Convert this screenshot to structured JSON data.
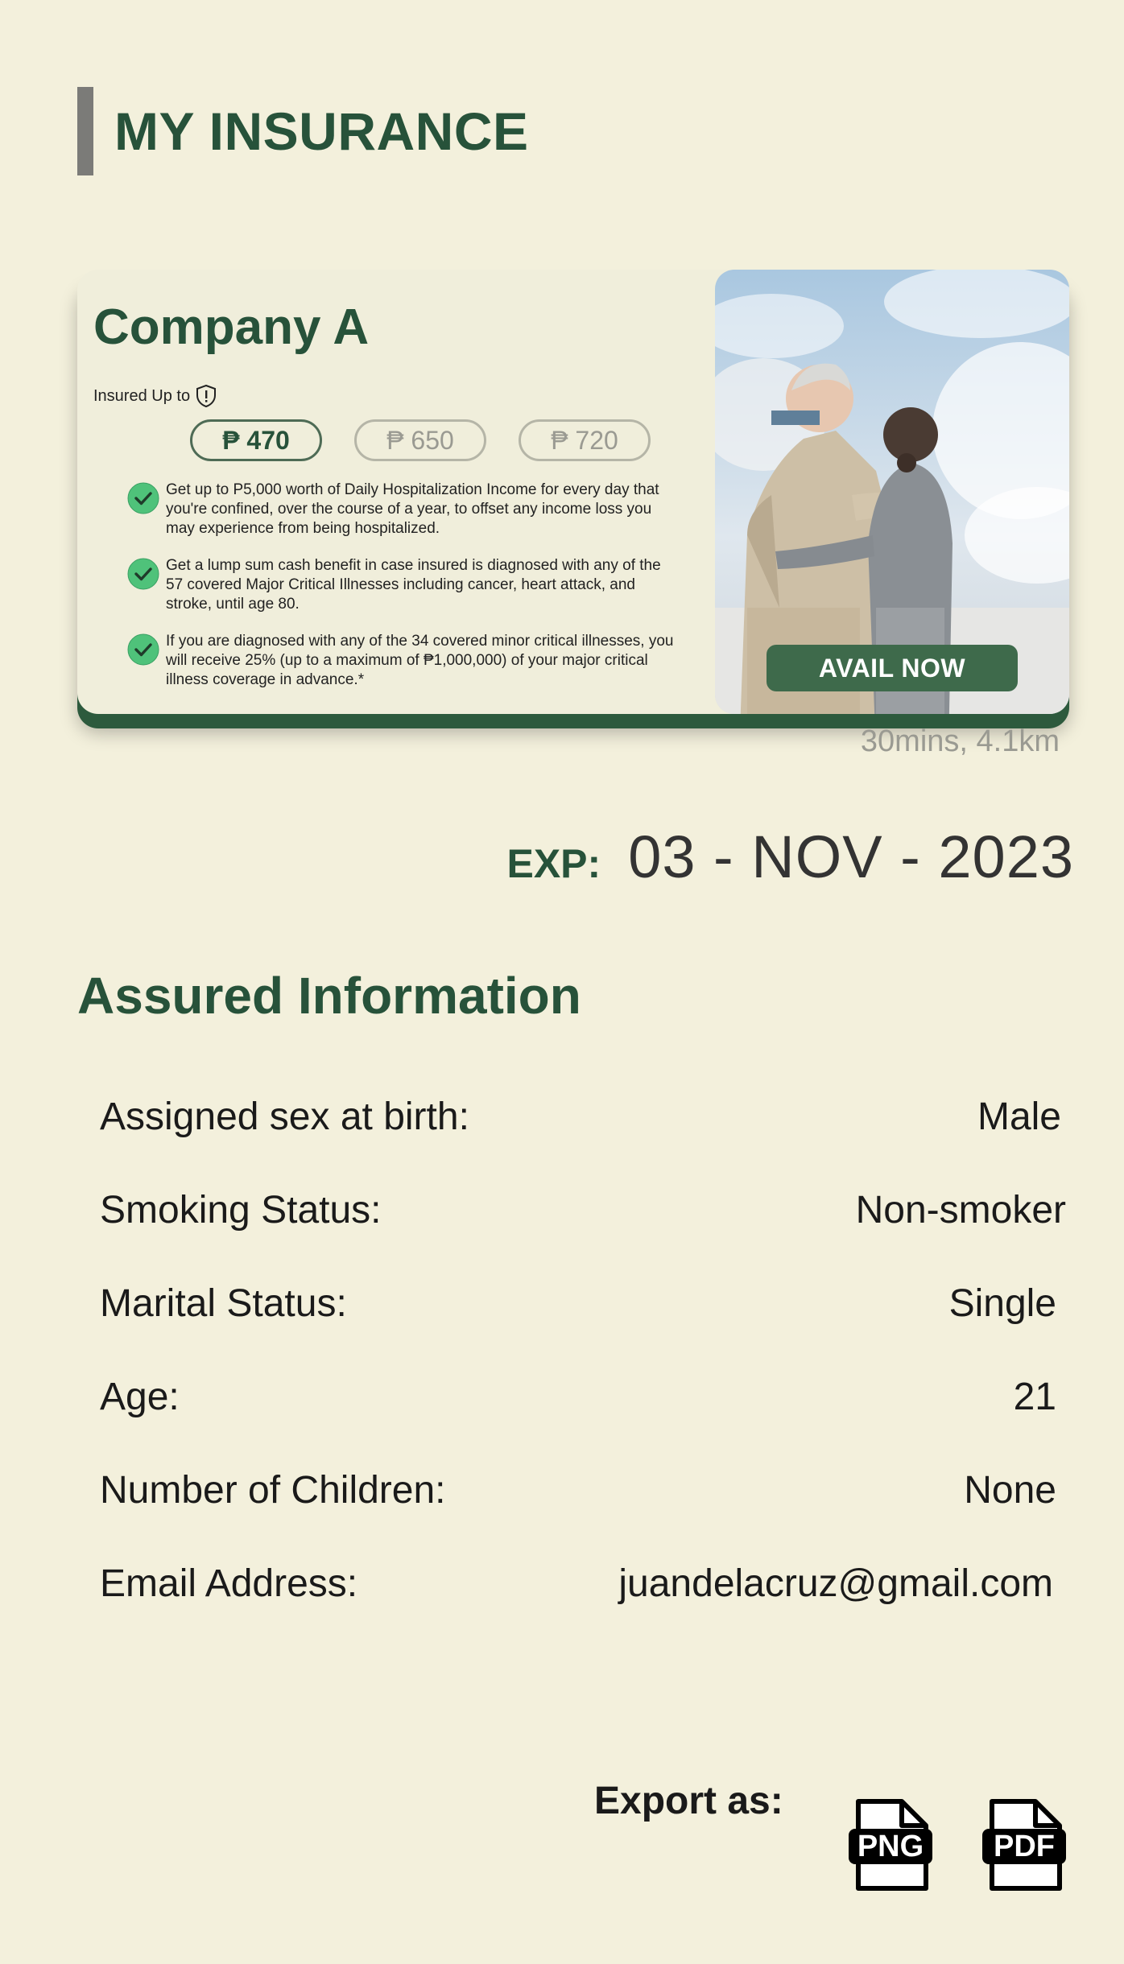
{
  "header": {
    "title": "MY INSURANCE"
  },
  "card": {
    "company": "Company A",
    "insured_label": "Insured Up to",
    "prices": [
      {
        "label": "₱ 470",
        "selected": true
      },
      {
        "label": "₱ 650",
        "selected": false
      },
      {
        "label": "₱ 720",
        "selected": false
      }
    ],
    "benefits": [
      "Get up to P5,000 worth of Daily Hospitalization Income for every day that you're confined, over the course of a year, to offset any income loss you may experience from being hospitalized.",
      "Get a lump sum cash benefit in case insured is diagnosed with any of the 57 covered Major Critical Illnesses including cancer, heart attack, and stroke, until age 80.",
      "If you are diagnosed with any of the 34 covered minor critical illnesses, you will receive 25% (up to a maximum of ₱1,000,000) of your major critical illness coverage in advance.*"
    ],
    "avail_label": "AVAIL NOW",
    "distance": "30mins, 4.1km"
  },
  "expiry": {
    "label": "EXP:",
    "date": "03 - NOV - 2023"
  },
  "assured": {
    "title": "Assured Information",
    "rows": [
      {
        "label": "Assigned sex at birth:",
        "value": "Male"
      },
      {
        "label": "Smoking Status:",
        "value": "Non-smoker"
      },
      {
        "label": "Marital Status:",
        "value": "Single"
      },
      {
        "label": "Age:",
        "value": "21"
      },
      {
        "label": "Number of Children:",
        "value": "None"
      },
      {
        "label": "Email Address:",
        "value": "juandelacruz@gmail.com"
      }
    ]
  },
  "export": {
    "label": "Export as:",
    "png": "PNG",
    "pdf": "PDF"
  },
  "colors": {
    "background": "#f3f0dc",
    "brand_green": "#27523a",
    "button_green": "#3e6a4b",
    "check_green": "#4fc27a"
  }
}
